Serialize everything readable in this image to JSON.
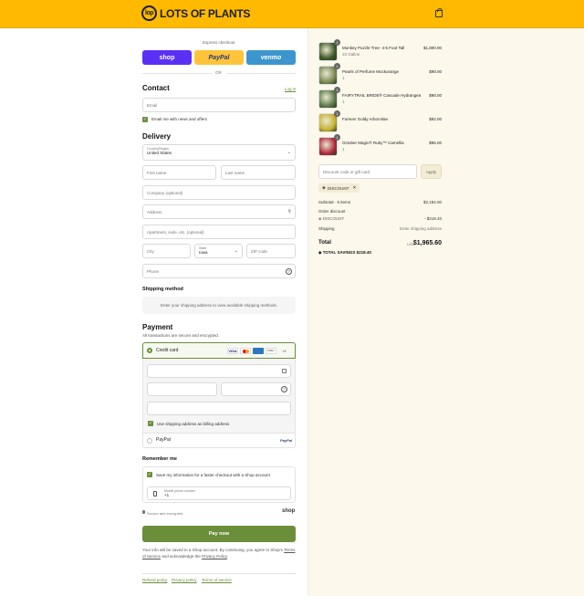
{
  "brand": {
    "name": "LOTS OF PLANTS",
    "mark": "lop"
  },
  "express": {
    "title": "Express checkout",
    "shop": "shop",
    "paypal": "PayPal",
    "venmo": "venmo",
    "or": "OR"
  },
  "contact": {
    "title": "Contact",
    "login": "Log in",
    "email_placeholder": "Email",
    "newsletter": "Email me with news and offers"
  },
  "delivery": {
    "title": "Delivery",
    "country_label": "Country/Region",
    "country_value": "United States",
    "first_name": "First name",
    "last_name": "Last name",
    "company": "Company (optional)",
    "address": "Address",
    "apartment": "Apartment, suite, etc. (optional)",
    "city": "City",
    "state_label": "State",
    "state_value": "Iowa",
    "zip": "ZIP code",
    "phone": "Phone"
  },
  "shipping": {
    "title": "Shipping method",
    "note": "Enter your shipping address to view available shipping methods."
  },
  "payment": {
    "title": "Payment",
    "subtitle": "All transactions are secure and encrypted.",
    "credit_card": "Credit card",
    "card_more": "+4",
    "billing_same": "Use shipping address as billing address",
    "paypal": "PayPal",
    "paypal_logo": "PayPal"
  },
  "remember": {
    "title": "Remember me",
    "save_info": "Save my information for a faster checkout with a Shop account",
    "mobile_label": "Mobile phone number",
    "mobile_value": "+1",
    "secure": "Secure and encrypted",
    "shop": "shop"
  },
  "pay_button": "Pay now",
  "disclaimer": {
    "line1": "Your info will be saved to a Shop account. By continuing, you agree to Shop's",
    "tos": "Terms of Service",
    "middle": "and acknowledge the",
    "privacy": "Privacy Policy",
    "end": "."
  },
  "footer": {
    "refund": "Refund policy",
    "privacy": "Privacy policy",
    "terms": "Terms of service"
  },
  "cart": {
    "items": [
      {
        "name": "Monkey Puzzle Tree- 4-5 Foot Tall",
        "variant": "10 Gallon",
        "qty": "1",
        "price": "$1,800.00",
        "color": "#3d5a2a"
      },
      {
        "name": "Pearls of Perfume Mockorange",
        "variant": "1",
        "qty": "1",
        "price": "$98.00",
        "color": "#7d8a55"
      },
      {
        "name": "FAIRYTRAIL BRIDE® Cascade Hydrangea",
        "variant": "1",
        "qty": "1",
        "price": "$98.00",
        "color": "#5e7a4a"
      },
      {
        "name": "Forever Goldy Arborvitae",
        "variant": "",
        "qty": "1",
        "price": "$92.00",
        "color": "#c8b230"
      },
      {
        "name": "October Magic® Ruby™ Camellia",
        "variant": "1",
        "qty": "1",
        "price": "$96.00",
        "color": "#b22a3a"
      }
    ],
    "discount_placeholder": "Discount code or gift card",
    "apply": "Apply",
    "discount_tag": "DISCOUNT",
    "subtotal_label": "Subtotal · 5 items",
    "subtotal_value": "$2,184.00",
    "order_discount_label": "Order discount",
    "discount_label": "DISCOUNT",
    "discount_value": "- $218.40",
    "shipping_label": "Shipping",
    "shipping_value": "Enter shipping address",
    "total_label": "Total",
    "currency": "USD",
    "total_value": "$1,965.60",
    "savings_label": "TOTAL SAVINGS",
    "savings_value": "$218.40"
  },
  "colors": {
    "header": "#ffba00",
    "accent": "#6b8e3a",
    "shop": "#5a31f4",
    "paypal": "#ffc439",
    "venmo": "#3d95ce"
  }
}
